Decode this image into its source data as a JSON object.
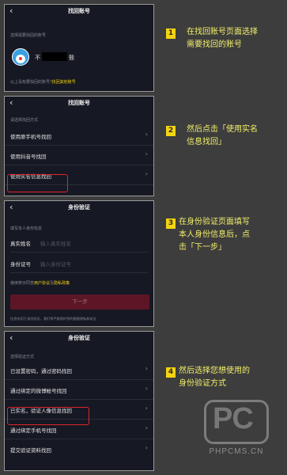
{
  "back_glyph": "‹",
  "arrow_glyph": "›",
  "screen1": {
    "title": "找回账号",
    "hint": "选择需要找回的账号",
    "account_prefix": "不",
    "account_suffix": "毂",
    "footer_text": "以上没有要找回的账号?",
    "footer_link": "找回其他账号"
  },
  "screen2": {
    "title": "找回账号",
    "hint": "请选择找回方式",
    "options": [
      "使用原手机号找回",
      "使用抖音号找回",
      "使用实名信息找回"
    ]
  },
  "screen3": {
    "title": "身份验证",
    "hint": "填写本人身份信息",
    "name_label": "真实姓名",
    "name_placeholder": "输入真实姓名",
    "id_label": "身份证号",
    "id_placeholder": "输入身份证号",
    "agree_prefix": "继续表示同意",
    "agree_link1": "用户协议",
    "agree_and": "及",
    "agree_link2": "隐私政策",
    "next_button": "下一步",
    "note": "信息仅用于身份验证，我们将严格保护您的数据隐私和安全"
  },
  "screen4": {
    "title": "身份验证",
    "hint": "选择验证方式",
    "options": [
      "已设置密码，通过密码找回",
      "通过绑定的微博帐号找回",
      "已实名，验证人像信息找回",
      "通过绑定手机号找回",
      "提交验证资料找回"
    ]
  },
  "captions": [
    {
      "num": "1",
      "lines": [
        "在找回账号页面选择",
        "需要找回的账号"
      ]
    },
    {
      "num": "2",
      "lines": [
        "然后点击「使用实名",
        "信息找回」"
      ]
    },
    {
      "num": "3",
      "lines": [
        "在身份验证页面填写",
        "本人身份信息后，点",
        "击「下一步」"
      ]
    },
    {
      "num": "4",
      "lines": [
        "然后选择您想使用的",
        "身份验证方式"
      ]
    }
  ],
  "watermark": {
    "logo": "PC",
    "site": "PHPCMS.CN"
  },
  "colors": {
    "accent": "#f5d40f",
    "highlight": "#e2232b",
    "link": "#f5d40f",
    "phone_bg": "#161823"
  }
}
